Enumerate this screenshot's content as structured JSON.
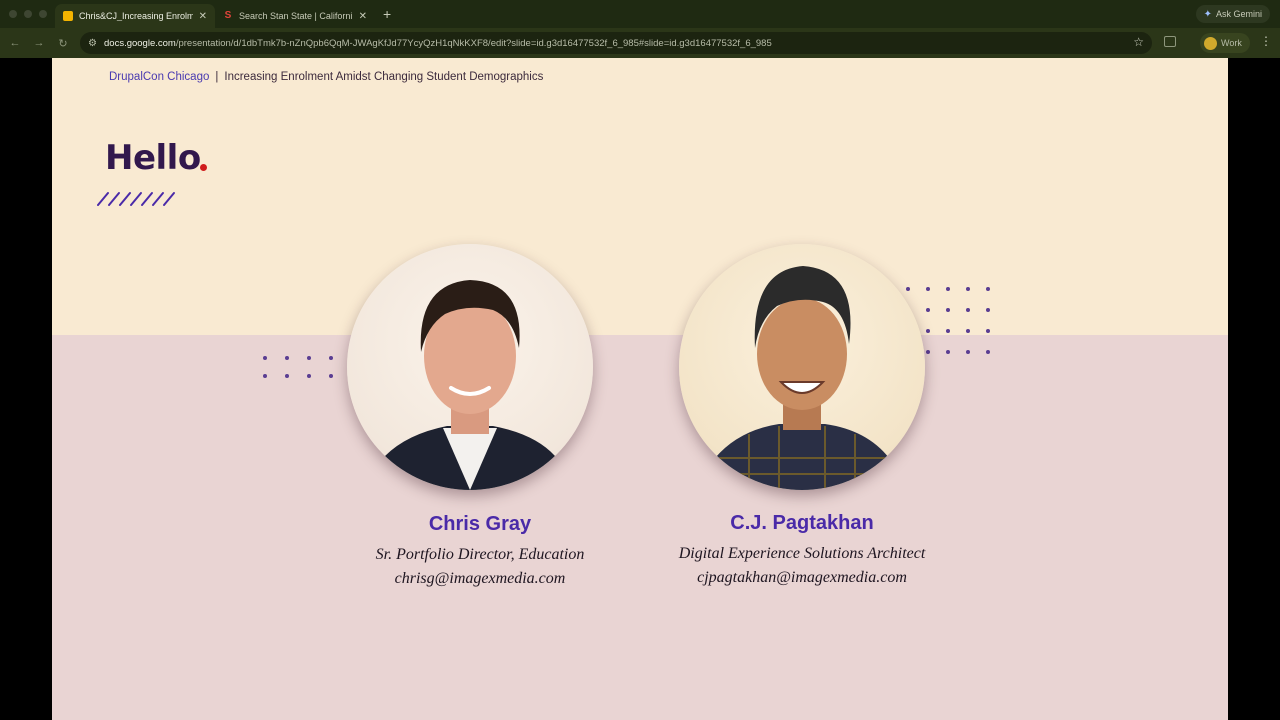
{
  "browser": {
    "tabs": [
      {
        "title": "Chris&CJ_Increasing Enrolm",
        "icon": "slides-icon",
        "active": true
      },
      {
        "title": "Search Stan State | Californi",
        "icon": "stan-state-icon",
        "active": false
      }
    ],
    "new_tab_symbol": "+",
    "ask_gemini": "Ask Gemini",
    "url_host": "docs.google.com",
    "url_path": "/presentation/d/1dbTmk7b-nZnQpb6QqM-JWAgKfJd77YcyQzH1qNkKXF8/edit?slide=id.g3d16477532f_6_985#slide=id.g3d16477532f_6_985",
    "profile_label": "Work"
  },
  "slide": {
    "breadcrumb_brand": "DrupalCon Chicago",
    "breadcrumb_sep": "|",
    "breadcrumb_title": "Increasing Enrolment Amidst Changing Student Demographics",
    "heading": "Hello",
    "people": [
      {
        "name": "Chris Gray",
        "role": "Sr. Portfolio Director, Education",
        "email": "chrisg@imagexmedia.com"
      },
      {
        "name": "C.J. Pagtakhan",
        "role": "Digital Experience Solutions Architect",
        "email": "cjpagtakhan@imagexmedia.com"
      }
    ]
  },
  "colors": {
    "slide_top": "#f9ead2",
    "slide_bottom": "#e9d4d3",
    "heading": "#32184d",
    "accent_dot": "#d01c1c",
    "name": "#4a2aa8",
    "dots": "#5a3d92"
  }
}
